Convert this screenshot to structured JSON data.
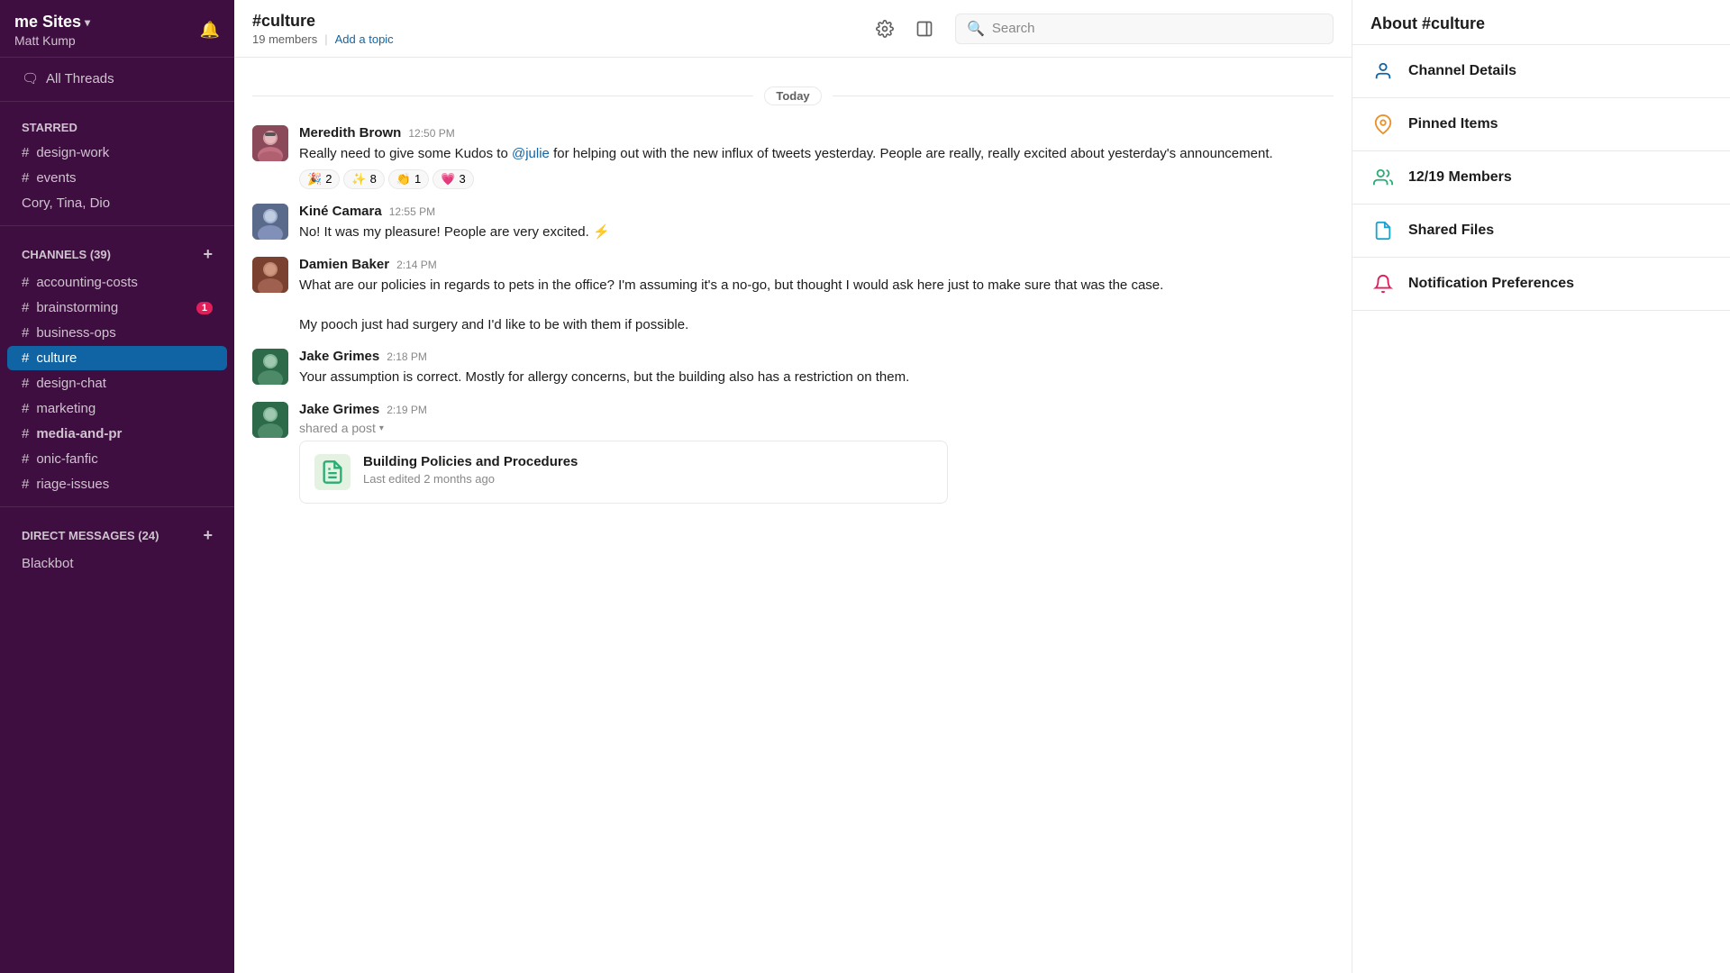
{
  "sidebar": {
    "workspace_label": "me Sites",
    "workspace_chevron": "▾",
    "user_name": "Matt Kump",
    "all_threads_label": "All Threads",
    "starred_label": "STARRED",
    "starred_items": [
      {
        "name": "design-work",
        "prefix": "#"
      },
      {
        "name": "events",
        "prefix": "#"
      },
      {
        "name": "Cory, Tina, Dio",
        "prefix": ""
      }
    ],
    "channels_label": "CHANNELS",
    "channels_count": "39",
    "channels": [
      {
        "name": "accounting-costs",
        "prefix": "#",
        "badge": null,
        "active": false
      },
      {
        "name": "brainstorming",
        "prefix": "#",
        "badge": "1",
        "active": false
      },
      {
        "name": "business-ops",
        "prefix": "#",
        "badge": null,
        "active": false
      },
      {
        "name": "culture",
        "prefix": "#",
        "badge": null,
        "active": true
      },
      {
        "name": "design-chat",
        "prefix": "#",
        "badge": null,
        "active": false
      },
      {
        "name": "marketing",
        "prefix": "#",
        "badge": null,
        "active": false
      },
      {
        "name": "media-and-pr",
        "prefix": "#",
        "badge": null,
        "active": false
      },
      {
        "name": "onic-fanfic",
        "prefix": "#",
        "badge": null,
        "active": false
      },
      {
        "name": "riage-issues",
        "prefix": "#",
        "badge": null,
        "active": false
      }
    ],
    "dm_label": "DIRECT MESSAGES",
    "dm_count": "24",
    "dm_items": [
      {
        "name": "Blackbot",
        "prefix": ""
      }
    ]
  },
  "channel": {
    "name": "#culture",
    "member_count": "19 members",
    "add_topic_label": "Add a topic"
  },
  "search": {
    "placeholder": "Search"
  },
  "date_divider": "Today",
  "messages": [
    {
      "id": "msg1",
      "sender": "Meredith Brown",
      "time": "12:50 PM",
      "avatar_color": "#c0392b",
      "avatar_emoji": "👩",
      "text_parts": [
        {
          "type": "text",
          "value": "Really need to give some Kudos to "
        },
        {
          "type": "mention",
          "value": "@julie"
        },
        {
          "type": "text",
          "value": " for helping out with the new influx of tweets yesterday. People are really, really excited about yesterday's announcement."
        }
      ],
      "reactions": [
        {
          "emoji": "🎉",
          "count": "2"
        },
        {
          "emoji": "✨",
          "count": "8"
        },
        {
          "emoji": "👏",
          "count": "1"
        },
        {
          "emoji": "💗",
          "count": "3"
        }
      ],
      "has_shared_post": false
    },
    {
      "id": "msg2",
      "sender": "Kiné Camara",
      "time": "12:55 PM",
      "avatar_color": "#6b4c8a",
      "avatar_emoji": "👨",
      "text_parts": [
        {
          "type": "text",
          "value": "No! It was my pleasure! People are very excited. ⚡"
        }
      ],
      "reactions": [],
      "has_shared_post": false
    },
    {
      "id": "msg3",
      "sender": "Damien Baker",
      "time": "2:14 PM",
      "avatar_color": "#c0392b",
      "avatar_emoji": "👨",
      "text_parts": [
        {
          "type": "text",
          "value": "What are our policies in regards to pets in the office? I'm assuming it's a no-go, but thought I would ask here just to make sure that was the case.\n\nMy pooch just had surgery and I'd like to be with them if possible."
        }
      ],
      "reactions": [],
      "has_shared_post": false
    },
    {
      "id": "msg4",
      "sender": "Jake Grimes",
      "time": "2:18 PM",
      "avatar_color": "#27ae60",
      "avatar_emoji": "👨",
      "text_parts": [
        {
          "type": "text",
          "value": "Your assumption is correct. Mostly for allergy concerns, but the building also has a restriction on them."
        }
      ],
      "reactions": [],
      "has_shared_post": false
    },
    {
      "id": "msg5",
      "sender": "Jake Grimes",
      "time": "2:19 PM",
      "avatar_color": "#27ae60",
      "avatar_emoji": "👨",
      "text_parts": [],
      "reactions": [],
      "has_shared_post": true,
      "shared_post_label": "shared a post",
      "post_card": {
        "title": "Building Policies and Procedures",
        "meta": "Last edited 2 months ago"
      }
    }
  ],
  "right_panel": {
    "title": "About #culture",
    "items": [
      {
        "id": "channel-details",
        "label": "Channel Details",
        "icon": "👤",
        "icon_class": "rp-icon-blue"
      },
      {
        "id": "pinned-items",
        "label": "Pinned Items",
        "icon": "📌",
        "icon_class": "rp-icon-orange"
      },
      {
        "id": "members",
        "label": "12/19 Members",
        "icon": "👥",
        "icon_class": "rp-icon-green"
      },
      {
        "id": "shared-files",
        "label": "Shared Files",
        "icon": "📋",
        "icon_class": "rp-icon-teal"
      },
      {
        "id": "notification-preferences",
        "label": "Notification Preferences",
        "icon": "🔔",
        "icon_class": "rp-icon-red"
      }
    ]
  }
}
